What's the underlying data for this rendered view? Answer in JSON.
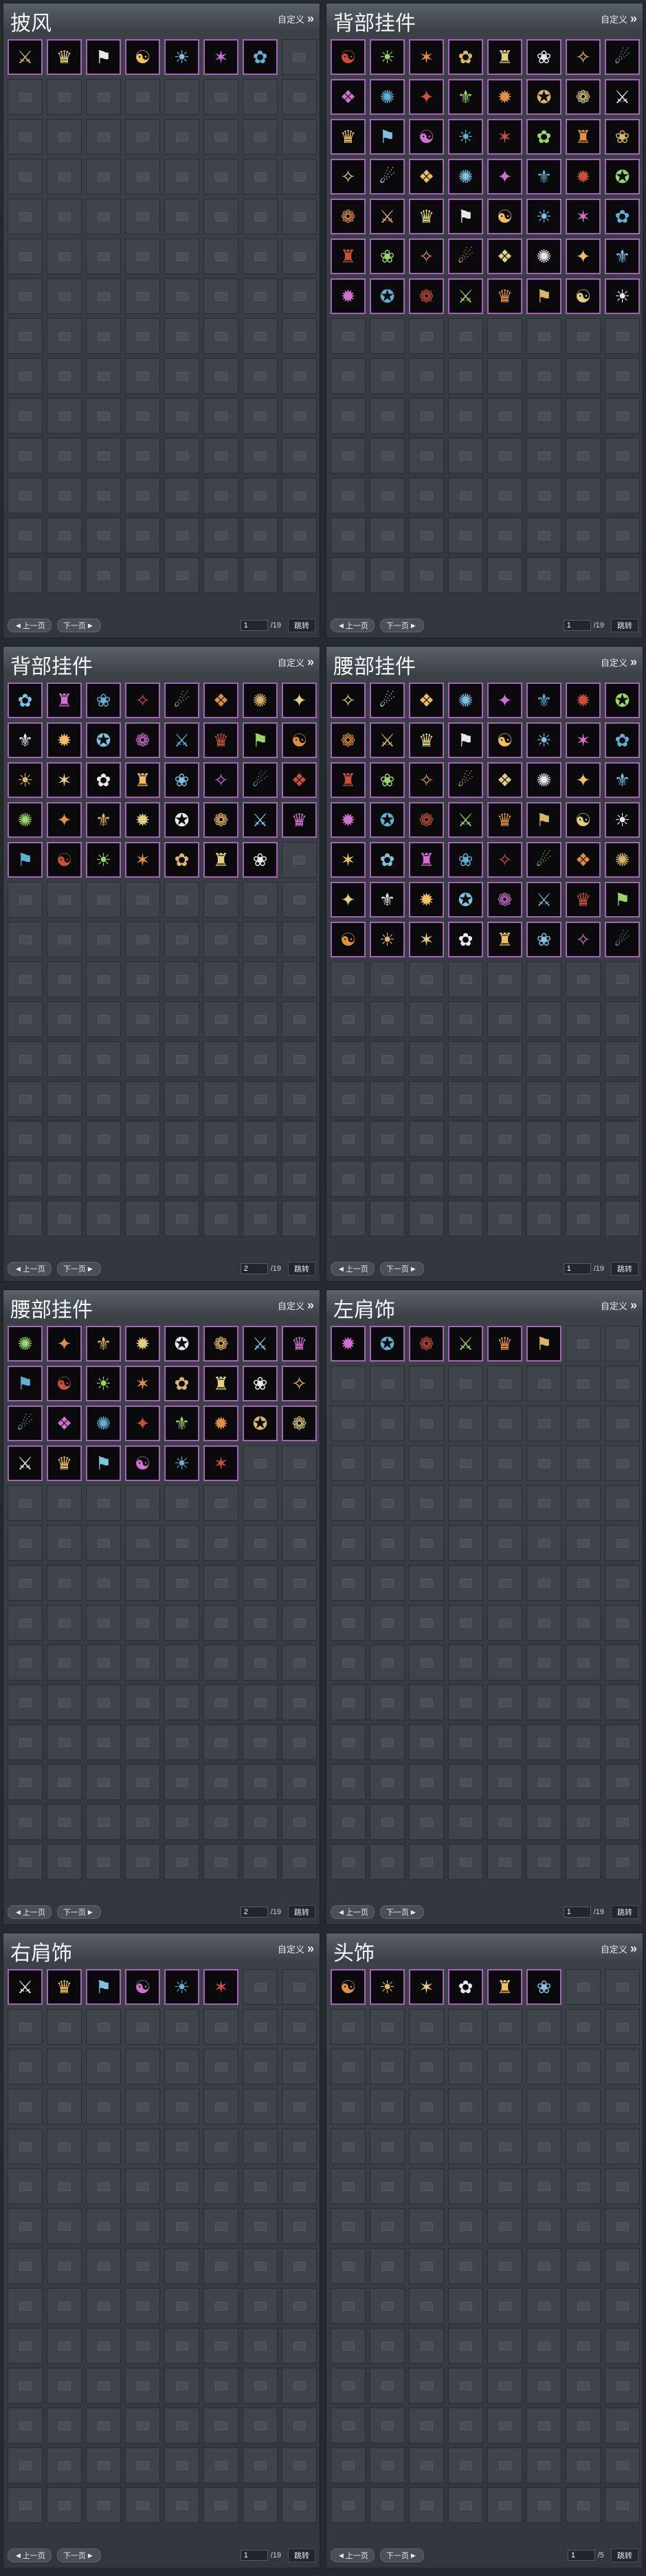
{
  "custom_label": "自定义",
  "prev_label": "上一页",
  "next_label": "下一页",
  "jump_label": "跳转",
  "panels": [
    {
      "title": "披风",
      "page": "1",
      "total": "/19",
      "items": 7
    },
    {
      "title": "背部挂件",
      "page": "1",
      "total": "/19",
      "items": 56
    },
    {
      "title": "背部挂件",
      "page": "2",
      "total": "/19",
      "items": 39
    },
    {
      "title": "腰部挂件",
      "page": "1",
      "total": "/19",
      "items": 56
    },
    {
      "title": "腰部挂件",
      "page": "2",
      "total": "/19",
      "items": 30
    },
    {
      "title": "左肩饰",
      "page": "1",
      "total": "/19",
      "items": 6
    },
    {
      "title": "右肩饰",
      "page": "1",
      "total": "/19",
      "items": 6
    },
    {
      "title": "头饰",
      "page": "1",
      "total": "/5",
      "items": 6
    }
  ],
  "item_icons": [
    "⚔",
    "✦",
    "❀",
    "☯",
    "✪",
    "❖",
    "✿",
    "♛",
    "⚜",
    "✧",
    "☀",
    "❁",
    "✺",
    "♜",
    "⚑",
    "✹",
    "☄",
    "✶"
  ],
  "item_colors": [
    "#d9b56a",
    "#c8503a",
    "#7fc2e0",
    "#e0d080",
    "#9ad46a",
    "#d070d0",
    "#e8e8e8",
    "#e09040",
    "#60b0d0",
    "#f0c060"
  ]
}
